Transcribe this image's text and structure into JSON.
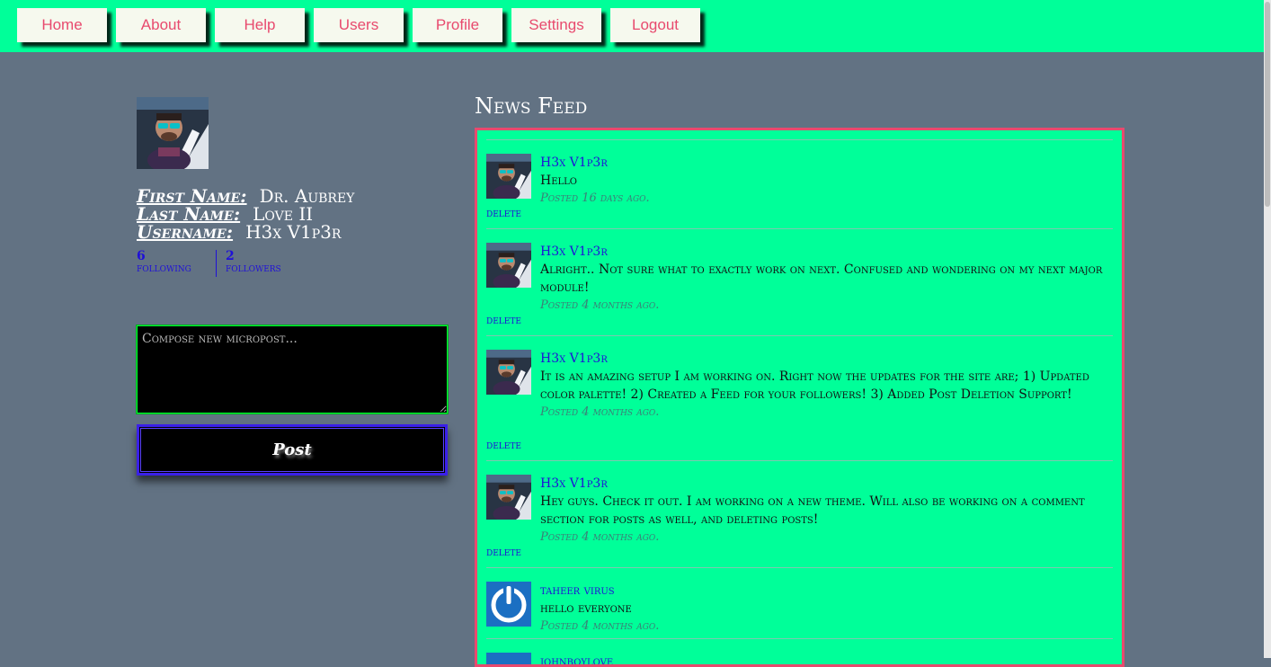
{
  "nav": {
    "items": [
      "Home",
      "About",
      "Help",
      "Users",
      "Profile",
      "Settings",
      "Logout"
    ]
  },
  "profile": {
    "first_name_label": "First Name:",
    "first_name": "Dr. Aubrey",
    "last_name_label": "Last Name:",
    "last_name": "Love II",
    "username_label": "Username:",
    "username": "H3x V1p3r",
    "following_count": "6",
    "following_label": "following",
    "followers_count": "2",
    "followers_label": "followers"
  },
  "compose": {
    "placeholder": "Compose new micropost...",
    "post_label": "Post"
  },
  "feed": {
    "title": "News Feed",
    "delete_label": "delete",
    "posts": [
      {
        "user": "H3x V1p3r",
        "content": "Hello",
        "time": "Posted 16 days ago."
      },
      {
        "user": "H3x V1p3r",
        "content": "Alright.. Not sure what to exactly work on next. Confused and wondering on my next major module!",
        "time": "Posted 4 months ago."
      },
      {
        "user": "H3x V1p3r",
        "content": "It is an amazing setup I am working on. Right now the updates for the site are; 1) Updated color palette! 2) Created a Feed for your followers! 3) Added Post Deletion Support!",
        "time": "Posted 4 months ago."
      },
      {
        "user": "H3x V1p3r",
        "content": "Hey guys. Check it out. I am working on a new theme. Will also be working on a comment section for posts as well, and deleting posts!",
        "time": "Posted 4 months ago."
      },
      {
        "user": "taheer virus",
        "content": "hello everyone",
        "time": "Posted 4 months ago."
      },
      {
        "user": "johnboylove",
        "content": "",
        "time": ""
      }
    ]
  },
  "colors": {
    "nav_bg": "#00ff99",
    "page_bg": "#627283",
    "accent_pink": "#e84a6e",
    "link_blue": "#1f10d8"
  }
}
